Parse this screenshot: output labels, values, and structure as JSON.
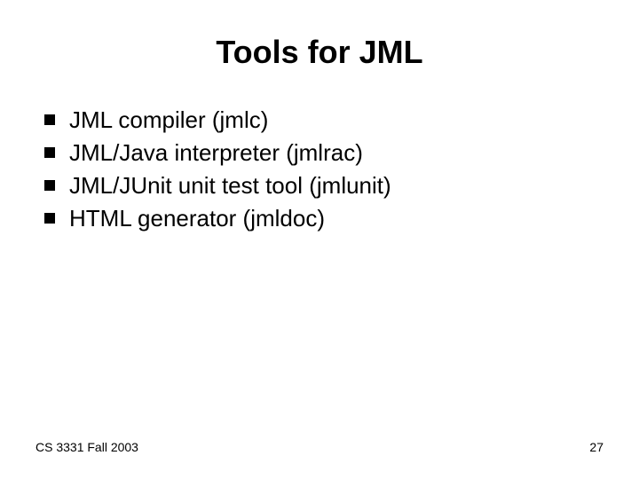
{
  "slide": {
    "title": "Tools for JML",
    "bullets": [
      "JML compiler (jmlc)",
      "JML/Java interpreter (jmlrac)",
      "JML/JUnit unit test tool (jmlunit)",
      "HTML generator (jmldoc)"
    ],
    "footer_left": "CS 3331 Fall 2003",
    "footer_right": "27"
  }
}
